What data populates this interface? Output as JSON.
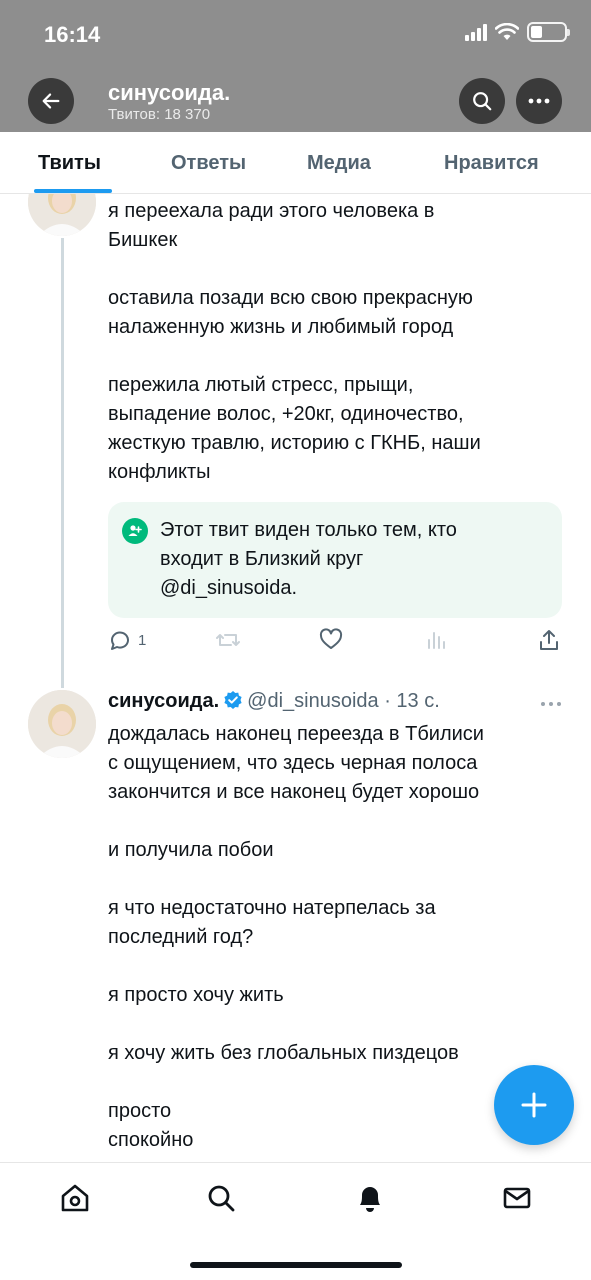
{
  "status_bar": {
    "time": "16:14"
  },
  "profile": {
    "name": "синусоида.",
    "tweet_count": "Твитов: 18 370"
  },
  "tabs": [
    {
      "label": "Твиты"
    },
    {
      "label": "Ответы"
    },
    {
      "label": "Медиа"
    },
    {
      "label": "Нравится"
    }
  ],
  "tweet1": {
    "lines": [
      "я переехала ради этого человека в",
      "Бишкек",
      "оставила позади всю свою прекрасную",
      "налаженную жизнь и любимый город",
      "пережила лютый стресс, прыщи,",
      "выпадение волос, +20кг, одиночество,",
      "жесткую травлю, историю с ГКНБ, наши",
      "конфликты"
    ],
    "circle_notice": {
      "line1": "Этот твит виден только тем, кто",
      "line2": "входит в Близкий круг",
      "line3": "@di_sinusoida."
    },
    "reply_count": "1"
  },
  "tweet2": {
    "author_name": "синусоида.",
    "handle": "@di_sinusoida",
    "time": "· 13 с.",
    "lines": [
      "дождалась наконец переезда в Тбилиси",
      "с ощущением, что здесь черная полоса",
      "закончится и все наконец будет хорошо",
      "и получила побои",
      "я что недостаточно натерпелась за",
      "последний год?",
      "я просто хочу жить",
      "я хочу жить без глобальных пиздецов",
      "просто",
      "спокойно"
    ]
  },
  "colors": {
    "accent": "#1d9bf0",
    "header_bg": "#8e8e8e",
    "circle_green": "#00ba7c"
  },
  "icons": [
    "back-arrow-icon",
    "search-icon",
    "more-icon",
    "reply-icon",
    "retweet-icon",
    "like-icon",
    "views-icon",
    "share-icon",
    "home-icon",
    "notifications-icon",
    "messages-icon",
    "compose-icon"
  ]
}
